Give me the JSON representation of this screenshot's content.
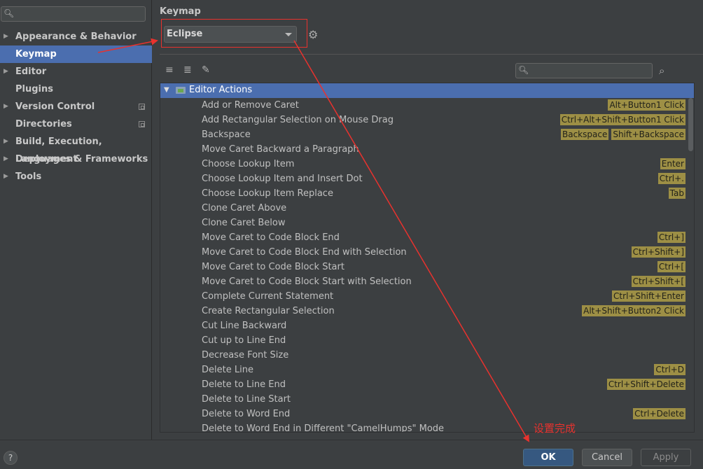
{
  "sidebar": {
    "search": {
      "placeholder": "",
      "value": ""
    },
    "items": [
      {
        "label": "Appearance & Behavior",
        "expandable": true,
        "selected": false,
        "project_icon": false
      },
      {
        "label": "Keymap",
        "expandable": false,
        "selected": true,
        "project_icon": false
      },
      {
        "label": "Editor",
        "expandable": true,
        "selected": false,
        "project_icon": false
      },
      {
        "label": "Plugins",
        "expandable": false,
        "selected": false,
        "project_icon": false
      },
      {
        "label": "Version Control",
        "expandable": true,
        "selected": false,
        "project_icon": true
      },
      {
        "label": "Directories",
        "expandable": false,
        "selected": false,
        "project_icon": true
      },
      {
        "label": "Build, Execution, Deployment",
        "expandable": true,
        "selected": false,
        "project_icon": false
      },
      {
        "label": "Languages & Frameworks",
        "expandable": true,
        "selected": false,
        "project_icon": false
      },
      {
        "label": "Tools",
        "expandable": true,
        "selected": false,
        "project_icon": false
      }
    ]
  },
  "panel": {
    "title": "Keymap",
    "keymap_select": {
      "value": "Eclipse"
    },
    "toolbar_icons": [
      "expand-all-icon",
      "collapse-all-icon",
      "edit-icon"
    ],
    "tree_search": {
      "placeholder": "",
      "value": ""
    },
    "tree": {
      "group": "Editor Actions",
      "rows": [
        {
          "action": "Add or Remove Caret",
          "shortcuts": [
            "Alt+Button1 Click"
          ]
        },
        {
          "action": "Add Rectangular Selection on Mouse Drag",
          "shortcuts": [
            "Ctrl+Alt+Shift+Button1 Click"
          ]
        },
        {
          "action": "Backspace",
          "shortcuts": [
            "Backspace",
            "Shift+Backspace"
          ]
        },
        {
          "action": "Move Caret Backward a Paragraph",
          "shortcuts": []
        },
        {
          "action": "Choose Lookup Item",
          "shortcuts": [
            "Enter"
          ]
        },
        {
          "action": "Choose Lookup Item and Insert Dot",
          "shortcuts": [
            "Ctrl+."
          ]
        },
        {
          "action": "Choose Lookup Item Replace",
          "shortcuts": [
            "Tab"
          ]
        },
        {
          "action": "Clone Caret Above",
          "shortcuts": []
        },
        {
          "action": "Clone Caret Below",
          "shortcuts": []
        },
        {
          "action": "Move Caret to Code Block End",
          "shortcuts": [
            "Ctrl+]"
          ]
        },
        {
          "action": "Move Caret to Code Block End with Selection",
          "shortcuts": [
            "Ctrl+Shift+]"
          ]
        },
        {
          "action": "Move Caret to Code Block Start",
          "shortcuts": [
            "Ctrl+["
          ]
        },
        {
          "action": "Move Caret to Code Block Start with Selection",
          "shortcuts": [
            "Ctrl+Shift+["
          ]
        },
        {
          "action": "Complete Current Statement",
          "shortcuts": [
            "Ctrl+Shift+Enter"
          ]
        },
        {
          "action": "Create Rectangular Selection",
          "shortcuts": [
            "Alt+Shift+Button2 Click"
          ]
        },
        {
          "action": "Cut Line Backward",
          "shortcuts": []
        },
        {
          "action": "Cut up to Line End",
          "shortcuts": []
        },
        {
          "action": "Decrease Font Size",
          "shortcuts": []
        },
        {
          "action": "Delete Line",
          "shortcuts": [
            "Ctrl+D"
          ]
        },
        {
          "action": "Delete to Line End",
          "shortcuts": [
            "Ctrl+Shift+Delete"
          ]
        },
        {
          "action": "Delete to Line Start",
          "shortcuts": []
        },
        {
          "action": "Delete to Word End",
          "shortcuts": [
            "Ctrl+Delete"
          ]
        },
        {
          "action": "Delete to Word End in Different \"CamelHumps\" Mode",
          "shortcuts": []
        }
      ]
    }
  },
  "footer": {
    "help_label": "?",
    "ok_label": "OK",
    "cancel_label": "Cancel",
    "apply_label": "Apply"
  },
  "annotation": {
    "text": "设置完成",
    "color": "#e8322e"
  },
  "colors": {
    "selection": "#4b6eaf",
    "shortcut_badge": "#9d8f45",
    "background": "#3c3f41"
  }
}
